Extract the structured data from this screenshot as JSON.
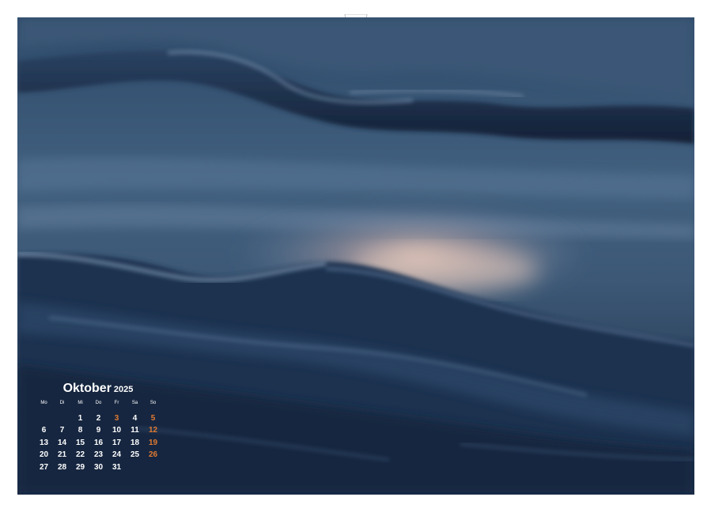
{
  "calendar": {
    "month": "Oktober",
    "year": "2025",
    "weekdays": [
      "Mo",
      "Di",
      "Mi",
      "Do",
      "Fr",
      "Sa",
      "So"
    ],
    "weekend_color": "#e07a32",
    "text_color": "#ffffff",
    "weeks": [
      [
        "",
        "",
        "1",
        "2",
        "3",
        "4",
        "5"
      ],
      [
        "6",
        "7",
        "8",
        "9",
        "10",
        "11",
        "12"
      ],
      [
        "13",
        "14",
        "15",
        "16",
        "17",
        "18",
        "19"
      ],
      [
        "20",
        "21",
        "22",
        "23",
        "24",
        "25",
        "26"
      ],
      [
        "27",
        "28",
        "29",
        "30",
        "31",
        "",
        ""
      ]
    ],
    "highlighted_days": [
      "3",
      "5",
      "12",
      "19",
      "26"
    ]
  },
  "photo": {
    "subject": "ocean-waves-long-exposure",
    "palette": [
      "#1d2f45",
      "#3c5878",
      "#6f8aa8",
      "#e8c6b4"
    ]
  }
}
